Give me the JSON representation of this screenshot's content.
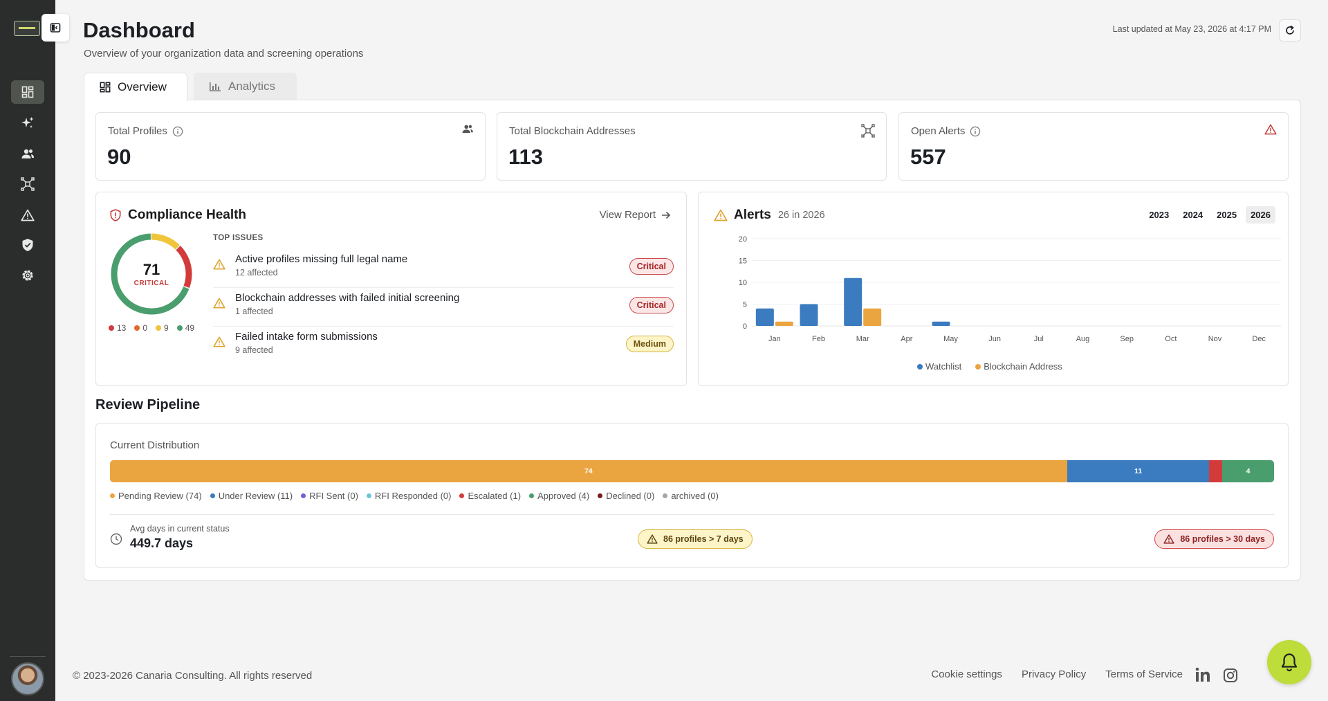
{
  "header": {
    "title": "Dashboard",
    "subtitle": "Overview of your organization data and screening operations",
    "last_updated": "Last updated at May 23, 2026 at 4:17 PM"
  },
  "tabs": [
    {
      "label": "Overview",
      "active": true
    },
    {
      "label": "Analytics",
      "active": false
    }
  ],
  "stats": [
    {
      "label": "Total Profiles",
      "value": "90",
      "icon": "users-icon"
    },
    {
      "label": "Total Blockchain Addresses",
      "value": "113",
      "icon": "network-icon"
    },
    {
      "label": "Open Alerts",
      "value": "557",
      "icon": "warning-icon"
    }
  ],
  "compliance": {
    "title": "Compliance Health",
    "view_report": "View Report",
    "score": "71",
    "score_label": "CRITICAL",
    "legend": [
      {
        "value": "13",
        "color": "#d33b3b"
      },
      {
        "value": "0",
        "color": "#e06a2c"
      },
      {
        "value": "9",
        "color": "#f0c53a"
      },
      {
        "value": "49",
        "color": "#4a9e6e"
      }
    ],
    "top_issues_label": "TOP ISSUES",
    "issues": [
      {
        "title": "Active profiles missing full legal name",
        "sub": "12 affected",
        "badge": "Critical"
      },
      {
        "title": "Blockchain addresses with failed initial screening",
        "sub": "1 affected",
        "badge": "Critical"
      },
      {
        "title": "Failed intake form submissions",
        "sub": "9 affected",
        "badge": "Medium"
      }
    ]
  },
  "alerts": {
    "title": "Alerts",
    "subtitle": "26 in 2026",
    "years": [
      "2023",
      "2024",
      "2025",
      "2026"
    ],
    "active_year": "2026"
  },
  "chart_data": {
    "type": "bar",
    "title": "Alerts",
    "categories": [
      "Jan",
      "Feb",
      "Mar",
      "Apr",
      "May",
      "Jun",
      "Jul",
      "Aug",
      "Sep",
      "Oct",
      "Nov",
      "Dec"
    ],
    "series": [
      {
        "name": "Watchlist",
        "color": "#3b7bbf",
        "values": [
          4,
          5,
          11,
          0,
          1,
          0,
          0,
          0,
          0,
          0,
          0,
          0
        ]
      },
      {
        "name": "Blockchain Address",
        "color": "#eba540",
        "values": [
          1,
          0,
          4,
          0,
          0,
          0,
          0,
          0,
          0,
          0,
          0,
          0
        ]
      }
    ],
    "yticks": [
      0,
      5,
      10,
      15,
      20
    ],
    "ylim": [
      0,
      20
    ],
    "grid": true,
    "legend_position": "bottom"
  },
  "pipeline": {
    "heading": "Review Pipeline",
    "distribution_label": "Current Distribution",
    "segments": [
      {
        "label": "Pending Review",
        "count": 74,
        "color": "#eba540"
      },
      {
        "label": "Under Review",
        "count": 11,
        "color": "#3b7bbf"
      },
      {
        "label": "RFI Sent",
        "count": 0,
        "color": "#7a5cd6"
      },
      {
        "label": "RFI Responded",
        "count": 0,
        "color": "#6cc6d8"
      },
      {
        "label": "Escalated",
        "count": 1,
        "color": "#d33b3b"
      },
      {
        "label": "Approved",
        "count": 4,
        "color": "#4a9e6e"
      },
      {
        "label": "Declined",
        "count": 0,
        "color": "#7a1c1c"
      },
      {
        "label": "archived",
        "count": 0,
        "color": "#a6a6a6"
      }
    ],
    "legend_texts": [
      "Pending Review (74)",
      "Under Review (11)",
      "RFI Sent (0)",
      "RFI Responded (0)",
      "Escalated (1)",
      "Approved (4)",
      "Declined (0)",
      "archived (0)"
    ],
    "avg_label": "Avg days in current status",
    "avg_value": "449.7 days",
    "chip_warn": "86 profiles > 7 days",
    "chip_danger": "86 profiles > 30 days"
  },
  "footer": {
    "copyright": "© 2023-2026 Canaria Consulting. All rights reserved",
    "links": [
      "Cookie settings",
      "Privacy Policy",
      "Terms of Service"
    ]
  }
}
